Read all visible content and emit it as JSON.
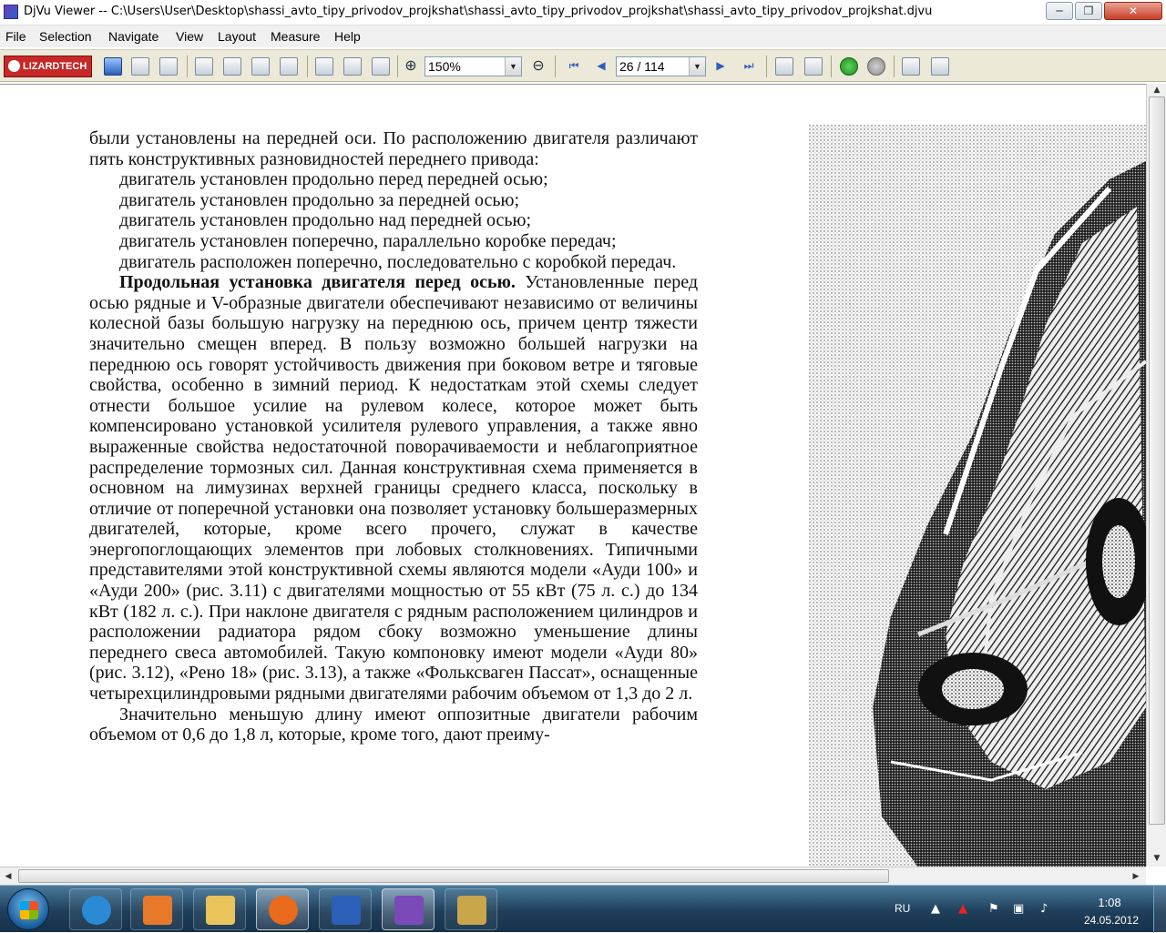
{
  "window": {
    "title": "DjVu Viewer -- C:\\Users\\User\\Desktop\\shassi_avto_tipy_privodov_projkshat\\shassi_avto_tipy_privodov_projkshat\\shassi_avto_tipy_privodov_projkshat.djvu",
    "min_glyph": "─",
    "max_glyph": "❐",
    "close_glyph": "✕"
  },
  "menu": [
    "File",
    "Selection",
    "Navigate",
    "View",
    "Layout",
    "Measure",
    "Help"
  ],
  "toolbar": {
    "brand": "LIZARDTECH",
    "zoom": "150%",
    "page": "26 / 114",
    "zoom_in_glyph": "⊕",
    "zoom_out_glyph": "⊖",
    "first_glyph": "⏮",
    "prev_glyph": "◀",
    "next_glyph": "▶",
    "last_glyph": "⏭",
    "dropdown_glyph": "▼",
    "icons": [
      "save-icon",
      "print-icon",
      "find-icon",
      "hand-icon",
      "text-select-icon",
      "zoom-select-icon",
      "ruler-icon",
      "page-icon",
      "fit-page-icon",
      "fit-width-icon",
      "first-page-icon",
      "prev-page-icon",
      "next-page-icon",
      "last-page-icon",
      "rotate-left-icon",
      "rotate-right-icon",
      "back-icon",
      "forward-icon",
      "single-page-icon",
      "thumbnails-icon"
    ]
  },
  "document": {
    "paragraphs": [
      {
        "cls": "",
        "text": "были установлены на передней оси. По расположению двигателя различают пять конструктивных разновидностей переднего привода:"
      },
      {
        "cls": "li",
        "text": "двигатель установлен продольно перед передней осью;"
      },
      {
        "cls": "li",
        "text": "двигатель установлен продольно за передней осью;"
      },
      {
        "cls": "li",
        "text": "двигатель установлен продольно над передней осью;"
      },
      {
        "cls": "li",
        "text": "двигатель установлен поперечно, параллельно коробке передач;"
      },
      {
        "cls": "li",
        "text": "двигатель расположен поперечно, последовательно с коробкой передач."
      }
    ],
    "bold_heading": "Продольная установка двигателя перед осью.",
    "main_paragraph": "Установленные перед осью рядные и V-образные двигатели обеспечивают независимо от величины колесной базы большую нагрузку на переднюю ось, причем центр тяжести значительно смещен вперед. В пользу возможно большей нагрузки на переднюю ось говорят устойчивость движения при боковом ветре и тяговые свойства, особенно в зимний период. К недостаткам этой схемы следует отнести большое усилие на рулевом колесе, которое может быть компенсировано установкой усилителя рулевого управления, а также явно выраженные свойства недостаточной поворачиваемости и неблагоприятное распределение тормозных сил. Данная конструктивная схема применяется в основном на лимузинах верхней границы среднего класса, поскольку в отличие от поперечной установки она позволяет установку большеразмерных двигателей, которые, кроме всего прочего, служат в качестве энергопоглощающих элементов при лобовых столкновениях. Типичными представителями этой конструктивной схемы являются модели «Ауди 100» и «Ауди 200» (рис. 3.11) с двигателями мощностью от 55 кВт (75 л. с.) до 134 кВт (182 л. с.). При наклоне двигателя с рядным расположением цилиндров и расположении радиатора рядом сбоку возможно уменьшение длины переднего свеса автомобилей. Такую компоновку имеют модели «Ауди 80» (рис. 3.12), «Рено 18» (рис. 3.13), а также «Фольксваген Пассат», оснащенные четырехцилиндровыми рядными двигателями рабочим объемом от 1,3 до 2 л.",
    "last_paragraph": "Значительно меньшую длину имеют оппозитные двигатели рабочим объемом от 0,6 до 1,8 л, которые, кроме того, дают преиму-"
  },
  "scrollbars": {
    "up": "▲",
    "down": "▼",
    "left": "◀",
    "right": "▶"
  },
  "taskbar": {
    "apps": [
      {
        "name": "taskbar-ie",
        "color": "#2a8ad6"
      },
      {
        "name": "taskbar-media-player",
        "color": "#e8782a"
      },
      {
        "name": "taskbar-explorer",
        "color": "#e8c45a"
      },
      {
        "name": "taskbar-firefox",
        "color": "#e86a1a"
      },
      {
        "name": "taskbar-word",
        "color": "#2b5fb8"
      },
      {
        "name": "taskbar-djvu",
        "color": "#7a4ab8"
      },
      {
        "name": "taskbar-keys",
        "color": "#c9a64a"
      }
    ],
    "language": "RU",
    "time": "1:08",
    "date": "24.05.2012"
  }
}
